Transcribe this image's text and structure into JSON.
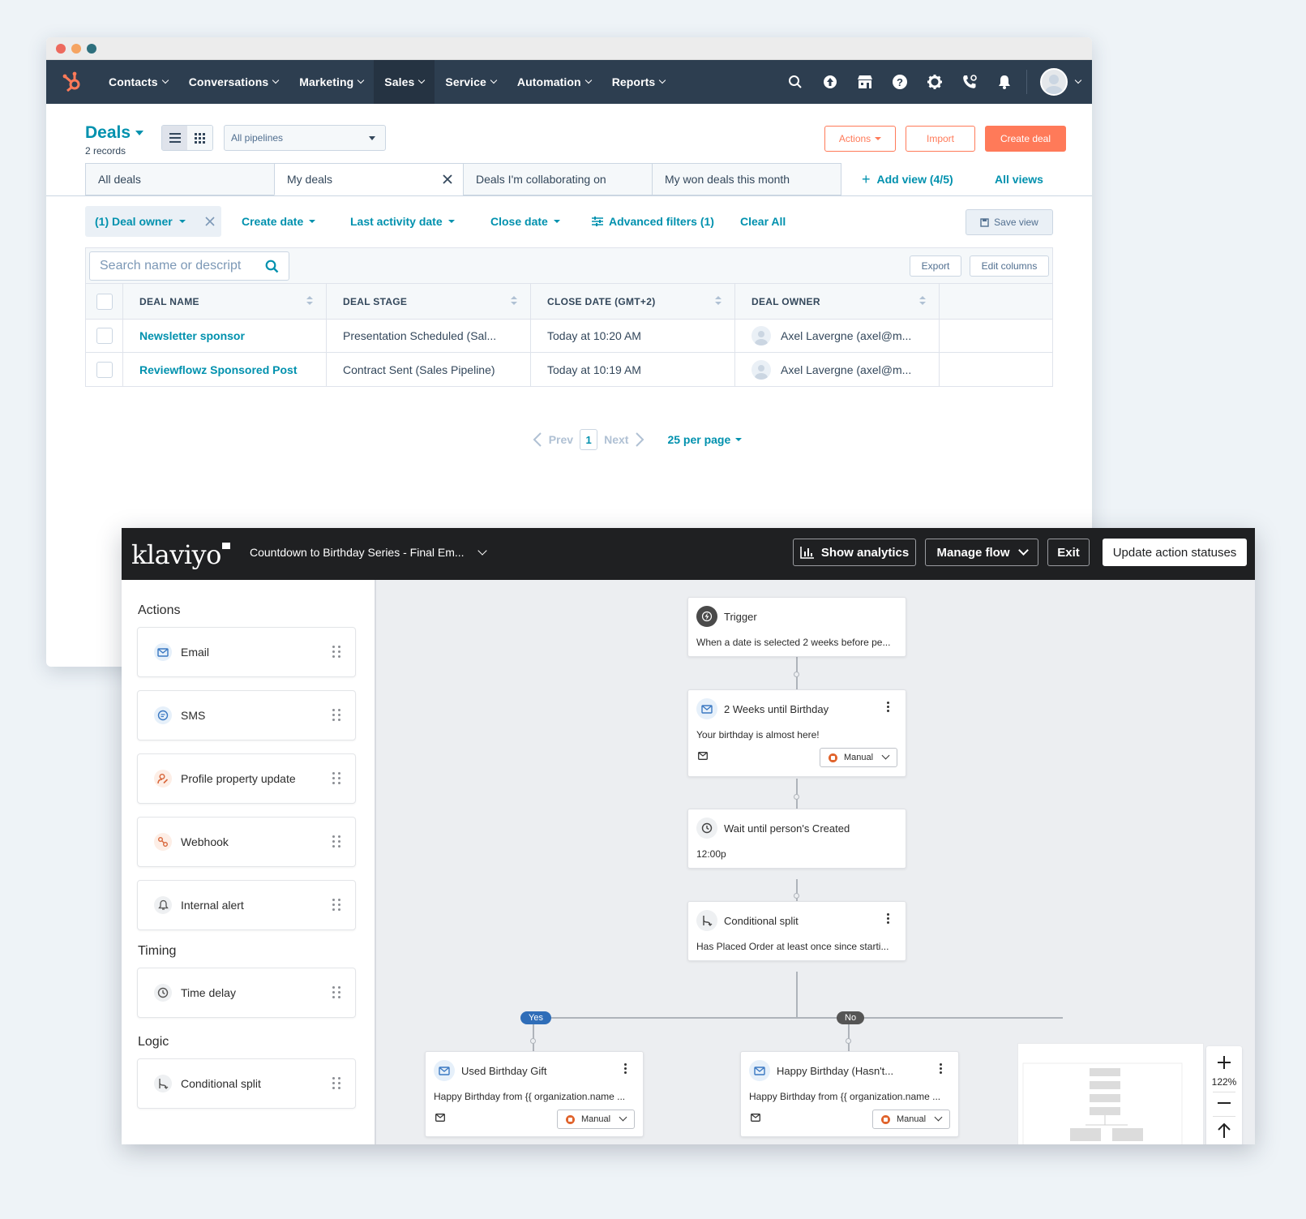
{
  "hubspot": {
    "nav": {
      "items": [
        "Contacts",
        "Conversations",
        "Marketing",
        "Sales",
        "Service",
        "Automation",
        "Reports"
      ],
      "active": "Sales"
    },
    "header": {
      "title": "Deals",
      "records": "2 records",
      "pipeline": "All pipelines",
      "actions_label": "Actions",
      "import_label": "Import",
      "create_label": "Create deal"
    },
    "tabs": [
      "All deals",
      "My deals",
      "Deals I'm collaborating on",
      "My won deals this month"
    ],
    "add_view": "Add view (4/5)",
    "all_views": "All views",
    "filters": {
      "deal_owner": "(1) Deal owner",
      "create_date": "Create date",
      "last_activity": "Last activity date",
      "close_date": "Close date",
      "advanced": "Advanced filters (1)",
      "clear": "Clear All",
      "save_view": "Save view"
    },
    "table": {
      "search_placeholder": "Search name or descript",
      "export": "Export",
      "edit_columns": "Edit columns",
      "columns": [
        "DEAL NAME",
        "DEAL STAGE",
        "CLOSE DATE (GMT+2)",
        "DEAL OWNER"
      ],
      "rows": [
        {
          "name": "Newsletter sponsor",
          "stage": "Presentation Scheduled (Sal...",
          "close": "Today at 10:20 AM",
          "owner": "Axel Lavergne (axel@m..."
        },
        {
          "name": "Reviewflowz Sponsored Post",
          "stage": "Contract Sent (Sales Pipeline)",
          "close": "Today at 10:19 AM",
          "owner": "Axel Lavergne (axel@m..."
        }
      ]
    },
    "pager": {
      "prev": "Prev",
      "page": "1",
      "next": "Next",
      "per_page": "25 per page"
    },
    "colors": {
      "nav": "#2d3e50",
      "accent": "#ff7a59",
      "link": "#0091ae"
    }
  },
  "klaviyo": {
    "logo": "klaviyo",
    "flow_name": "Countdown to Birthday Series - Final Em...",
    "buttons": {
      "analytics": "Show analytics",
      "manage": "Manage flow",
      "exit": "Exit",
      "update": "Update action statuses"
    },
    "sidebar": {
      "actions_title": "Actions",
      "actions": [
        "Email",
        "SMS",
        "Profile property update",
        "Webhook",
        "Internal alert"
      ],
      "timing_title": "Timing",
      "timing": [
        "Time delay"
      ],
      "logic_title": "Logic",
      "logic": [
        "Conditional split"
      ]
    },
    "nodes": {
      "trigger": {
        "title": "Trigger",
        "sub": "When a date is selected 2 weeks before pe..."
      },
      "email1": {
        "title": "2 Weeks until Birthday",
        "sub": "Your birthday is almost here!",
        "status": "Manual"
      },
      "wait": {
        "title": "Wait until person's Created",
        "sub": "12:00p"
      },
      "split": {
        "title": "Conditional split",
        "sub": "Has Placed Order at least once since starti..."
      },
      "yes_label": "Yes",
      "no_label": "No",
      "yes_email": {
        "title": "Used Birthday Gift",
        "sub": "Happy Birthday from {{ organization.name ...",
        "status": "Manual"
      },
      "no_email": {
        "title": "Happy Birthday (Hasn't...",
        "sub": "Happy Birthday from {{ organization.name ...",
        "status": "Manual"
      }
    },
    "zoom": "122%",
    "colors": {
      "topbar": "#1f2022",
      "yes": "#2f6db8",
      "no": "#555555",
      "manual": "#e0632c"
    }
  }
}
